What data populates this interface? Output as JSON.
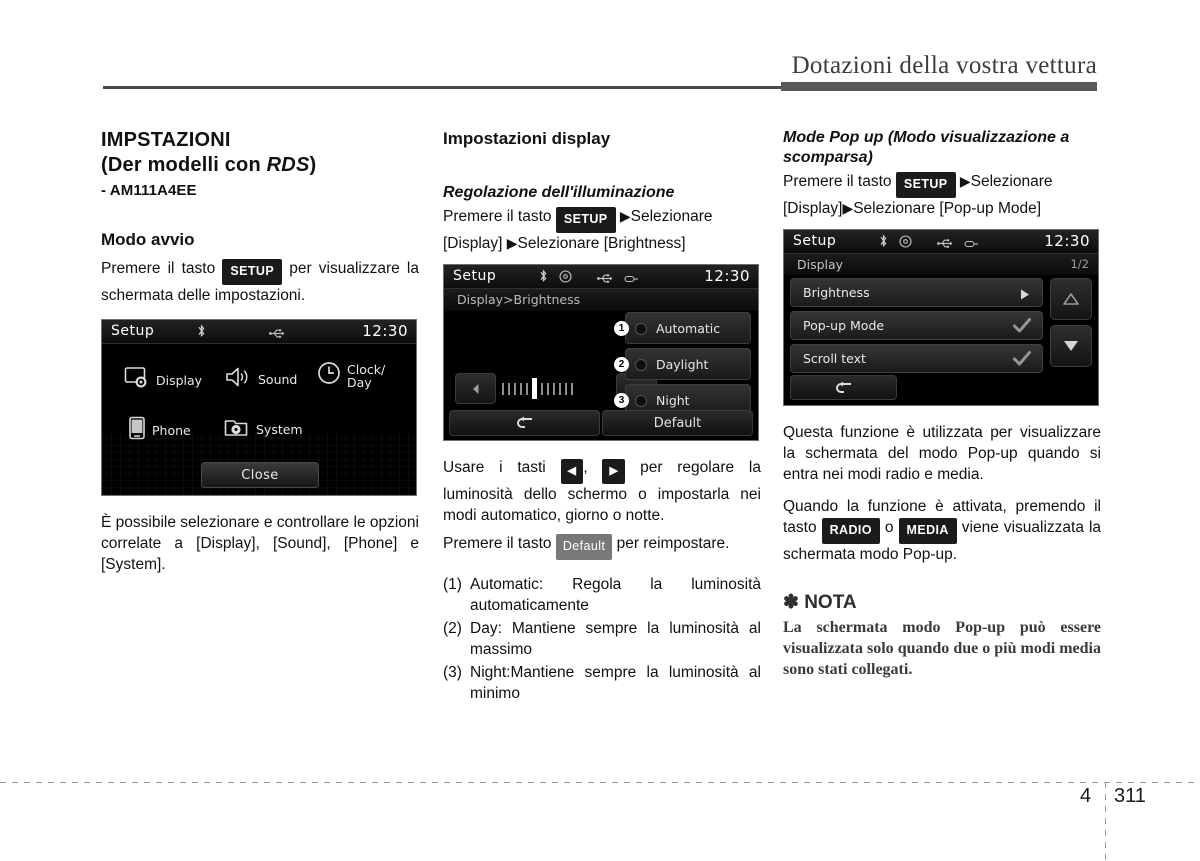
{
  "header": {
    "title": "Dotazioni della vostra vettura"
  },
  "col1": {
    "section_title_line1": "IMPSTAZIONI",
    "section_title_line2_pre": "(Der modelli con ",
    "section_title_line2_ital": "RDS",
    "section_title_line2_post": ")",
    "model_code": "- AM111A4EE",
    "sub_title": "Modo avvio",
    "para_pre": "Premere il tasto",
    "chip_setup": "SETUP",
    "para_post": "per visualizzare la schermata delle impostazioni.",
    "para_after": "È possibile selezionare e controllare le opzioni correlate a [Display], [Sound], [Phone] e [System].",
    "screen": {
      "title": "Setup",
      "clock": "12:30",
      "icons": [
        "bluetooth-icon",
        "usb-icon"
      ],
      "items": [
        {
          "label": "Display",
          "icon": "display-gear-icon"
        },
        {
          "label": "Sound",
          "icon": "speaker-icon"
        },
        {
          "label": "Clock/\nDay",
          "icon": "clock-icon"
        },
        {
          "label": "Phone",
          "icon": "phone-icon"
        },
        {
          "label": "System",
          "icon": "folder-gear-icon"
        }
      ],
      "close_label": "Close"
    }
  },
  "col2": {
    "sub_title": "Impostazioni display",
    "ital_title": "Regolazione dell'illuminazione",
    "para_pre": "Premere il tasto",
    "chip_setup": "SETUP",
    "para_mid": "Selezionare [Display]",
    "para_end": "Selezionare [Brightness]",
    "screen": {
      "title": "Setup",
      "clock": "12:30",
      "breadcrumb": "Display>Brightness",
      "options": [
        {
          "num": "1",
          "label": "Automatic"
        },
        {
          "num": "2",
          "label": "Daylight"
        },
        {
          "num": "3",
          "label": "Night"
        }
      ],
      "back_label": "back-icon",
      "default_label": "Default"
    },
    "para_use_pre": "Usare i tasti",
    "chip_left": "◀",
    "chip_right": "▶",
    "para_use_post": "per regolare la luminosità dello schermo o impostarla nei modi automatico, giorno o notte.",
    "para_def_pre": "Premere il tasto",
    "chip_default": "Default",
    "para_def_post": "per reimpostare.",
    "list": [
      {
        "num": "(1)",
        "text": "Automatic: Regola la luminosità automaticamente"
      },
      {
        "num": "(2)",
        "text": "Day: Mantiene sempre la luminosità al massimo"
      },
      {
        "num": "(3)",
        "text": "Night:Mantiene sempre la luminosità al minimo"
      }
    ]
  },
  "col3": {
    "ital_title_line1": "Mode Pop up (Modo visualizzazione a",
    "ital_title_line2": "scomparsa)",
    "para_pre": "Premere il tasto",
    "chip_setup": "SETUP",
    "para_mid": "Selezionare [Display]",
    "para_end": "Selezionare [Pop-up Mode]",
    "screen": {
      "title": "Setup",
      "clock": "12:30",
      "breadcrumb": "Display",
      "page_indicator": "1/2",
      "rows": [
        {
          "label": "Brightness",
          "marker": "arrow"
        },
        {
          "label": "Pop-up Mode",
          "marker": "check"
        },
        {
          "label": "Scroll text",
          "marker": "check"
        }
      ],
      "scroll_up": "scroll-up-icon",
      "scroll_down": "scroll-down-icon",
      "back_label": "back-icon"
    },
    "para_func": "Questa funzione è utilizzata per visualizzare la schermata del modo Pop-up quando si entra nei modi radio e media.",
    "para_when_pre": "Quando la funzione è attivata, premendo il tasto",
    "chip_radio": "RADIO",
    "para_or": "o",
    "chip_media": "MEDIA",
    "para_when_post": "viene visualizzata la schermata modo Pop-up.",
    "note_head": "✽ NOTA",
    "note_body": "La schermata modo Pop-up può essere visualizzata solo quando due o più modi media sono stati collegati."
  },
  "footer": {
    "chapter": "4",
    "page": "311"
  }
}
